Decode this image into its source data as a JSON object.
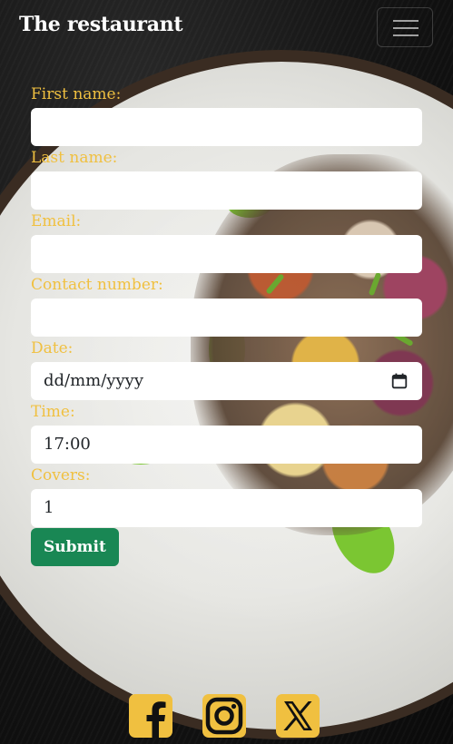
{
  "navbar": {
    "brand": "The restaurant",
    "toggler_icon": "hamburger-menu-icon"
  },
  "form": {
    "fields": [
      {
        "label": "First name:",
        "value": ""
      },
      {
        "label": "Last name:",
        "value": ""
      },
      {
        "label": "Email:",
        "value": ""
      },
      {
        "label": "Contact number:",
        "value": ""
      },
      {
        "label": "Date:",
        "value": "dd/mm/yyyy"
      },
      {
        "label": "Time:",
        "value": "17:00"
      },
      {
        "label": "Covers:",
        "value": "1"
      }
    ],
    "submit_label": "Submit",
    "label_color": "#f0c040",
    "submit_color": "#198754"
  },
  "social": {
    "icons": [
      "facebook-icon",
      "instagram-icon",
      "x-icon"
    ],
    "icon_color": "#f0c040"
  }
}
